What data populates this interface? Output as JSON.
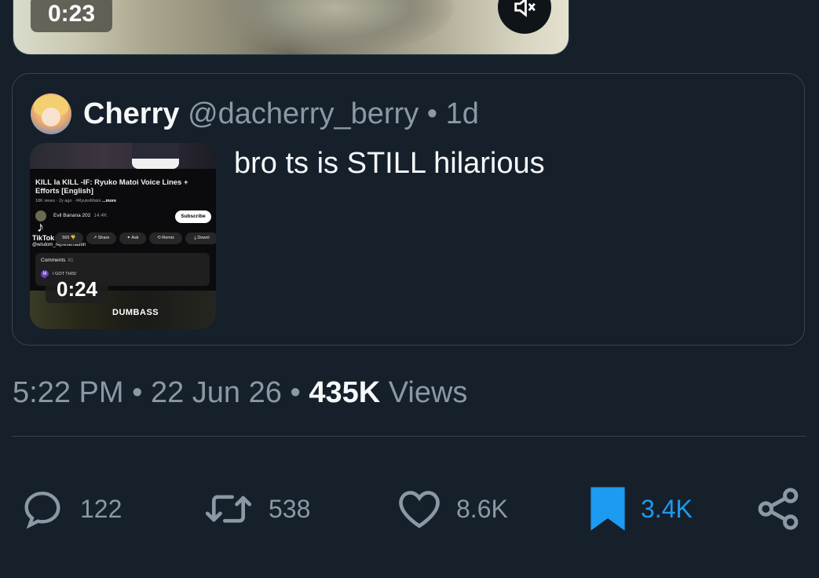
{
  "video": {
    "duration": "0:23",
    "mute_icon": "muted-speaker-icon"
  },
  "quote": {
    "name": "Cherry",
    "handle": "@dacherry_berry",
    "separator": "•",
    "time": "1d",
    "text": "bro ts is STILL hilarious",
    "media": {
      "duration": "0:24",
      "title": "KILL la KILL -IF: Ryuko Matoi Voice Lines + Efforts [English]",
      "meta": "18K views · 2y ago · #RyukoMatoi",
      "more": "...more",
      "channel": "Evil Banana 202",
      "subscribers": "14.4K",
      "subscribe": "Subscribe",
      "tiktok": "TikTok",
      "tiktok_user": "@wisdom_representation",
      "likes": "565",
      "pills": [
        "Share",
        "Ask",
        "Remix",
        "Downl"
      ],
      "comments_label": "Comments",
      "comments_count": "81",
      "comment_avatar": "M",
      "comment_text": "I GOT THIS!",
      "caption": "DUMBASS"
    }
  },
  "meta": {
    "time": "5:22 PM",
    "dot1": "•",
    "date": "22 Jun 26",
    "dot2": "•",
    "views_count": "435K",
    "views_label": "Views"
  },
  "actions": {
    "replies": "122",
    "reposts": "538",
    "likes": "8.6K",
    "bookmarks": "3.4K"
  },
  "colors": {
    "background": "#15202b",
    "border": "#38444d",
    "muted_text": "#8b98a5",
    "accent": "#1d9bf0"
  }
}
